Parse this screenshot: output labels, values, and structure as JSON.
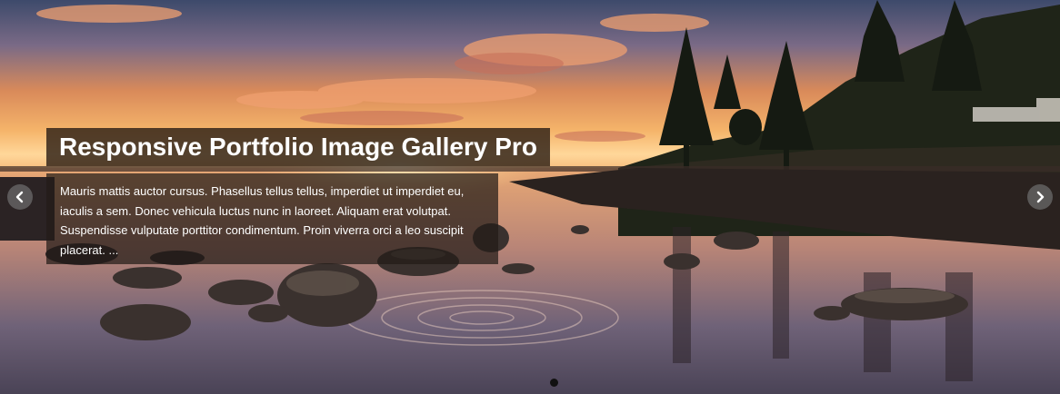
{
  "slide": {
    "title": "Responsive Portfolio Image Gallery Pro",
    "description": "Mauris mattis auctor cursus. Phasellus tellus tellus, imperdiet ut imperdiet eu, iaculis a sem. Donec vehicula luctus nunc in laoreet. Aliquam erat volutpat. Suspendisse vulputate porttitor condimentum. Proin viverra orci a leo suscipit placerat. ...",
    "image": "sunset-lake-with-rocks-and-pine-trees"
  },
  "navigation": {
    "prev_icon": "chevron-left-icon",
    "next_icon": "chevron-right-icon"
  },
  "pagination": {
    "active_index": 1,
    "count": 1
  },
  "colors": {
    "caption_background": "#2d2016",
    "arrow_background": "#6e6e6e",
    "dot_active": "#111111"
  }
}
